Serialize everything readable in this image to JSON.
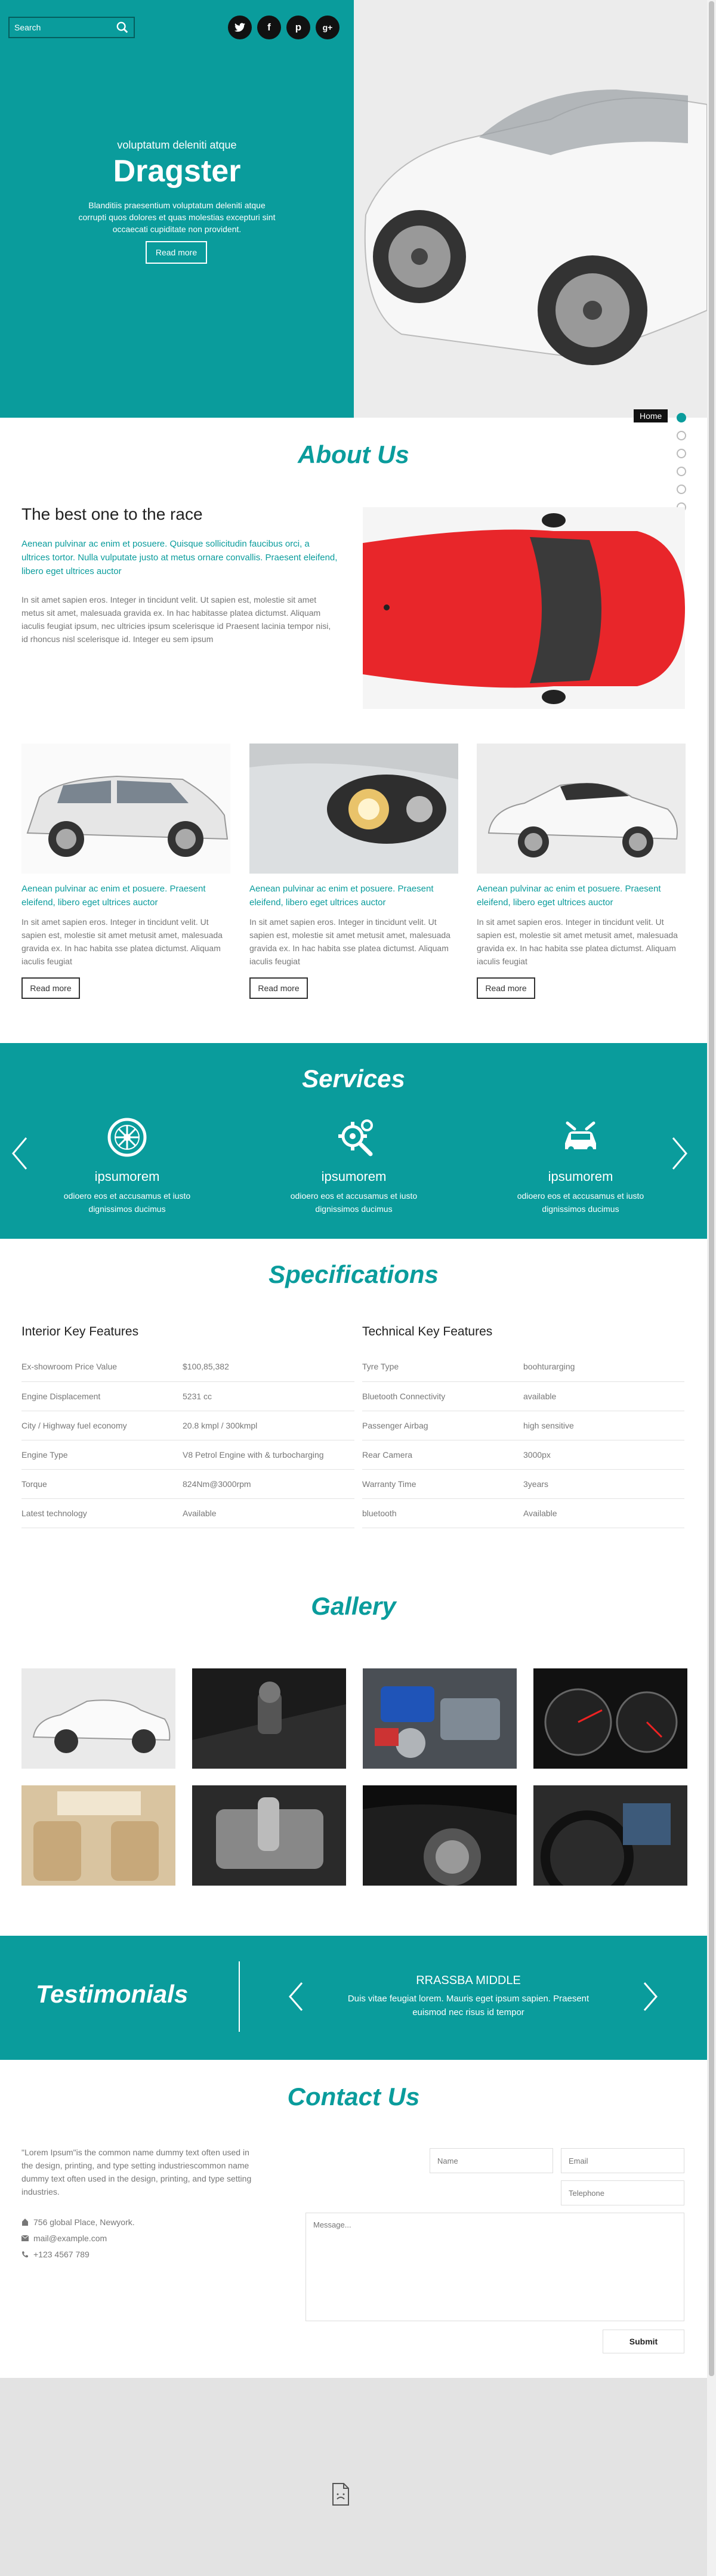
{
  "search": {
    "placeholder": "Search"
  },
  "social": [
    {
      "icon": "twitter-icon",
      "glyph": "t"
    },
    {
      "icon": "facebook-icon",
      "glyph": "f"
    },
    {
      "icon": "pinterest-icon",
      "glyph": "p"
    },
    {
      "icon": "google-plus-icon",
      "glyph": "g+"
    }
  ],
  "hero": {
    "subtitle": "voluptatum deleniti atque",
    "title": "Dragster",
    "text": "Blanditiis praesentium voluptatum deleniti atque corrupti quos dolores et quas molestias excepturi sint occaecati cupiditate non provident.",
    "button": "Read more"
  },
  "nav": {
    "home": "Home",
    "dot_count": 6
  },
  "about": {
    "title": "About Us",
    "heading": "The best one to the race",
    "lead": "Aenean pulvinar ac enim et posuere. Quisque sollicitudin faucibus orci, a ultrices tortor. Nulla vulputate justo at metus ornare convallis. Praesent eleifend, libero eget ultrices auctor",
    "text": "In sit amet sapien eros. Integer in tincidunt velit. Ut sapien est, molestie sit amet metus sit amet, malesuada gravida ex. In hac habitasse platea dictumst. Aliquam iaculis feugiat ipsum, nec ultricies ipsum scelerisque id Praesent lacinia tempor nisi, id rhoncus nisl scelerisque id. Integer eu sem ipsum"
  },
  "cards": [
    {
      "lead": "Aenean pulvinar ac enim et posuere. Praesent eleifend, libero eget ultrices auctor",
      "text": "In sit amet sapien eros. Integer in tincidunt velit. Ut sapien est, molestie sit amet metusit amet, malesuada gravida ex. In hac habita sse platea dictumst. Aliquam iaculis feugiat",
      "button": "Read more"
    },
    {
      "lead": "Aenean pulvinar ac enim et posuere. Praesent eleifend, libero eget ultrices auctor",
      "text": "In sit amet sapien eros. Integer in tincidunt velit. Ut sapien est, molestie sit amet metusit amet, malesuada gravida ex. In hac habita sse platea dictumst. Aliquam iaculis feugiat",
      "button": "Read more"
    },
    {
      "lead": "Aenean pulvinar ac enim et posuere. Praesent eleifend, libero eget ultrices auctor",
      "text": "In sit amet sapien eros. Integer in tincidunt velit. Ut sapien est, molestie sit amet metusit amet, malesuada gravida ex. In hac habita sse platea dictumst. Aliquam iaculis feugiat",
      "button": "Read more"
    }
  ],
  "services": {
    "title": "Services",
    "items": [
      {
        "icon": "wheel-icon",
        "name": "ipsumorem",
        "text": "odioero eos et accusamus et iusto dignissimos ducimus"
      },
      {
        "icon": "wrench-gear-icon",
        "name": "ipsumorem",
        "text": "odioero eos et accusamus et iusto dignissimos ducimus"
      },
      {
        "icon": "car-repair-icon",
        "name": "ipsumorem",
        "text": "odioero eos et accusamus et iusto dignissimos ducimus"
      }
    ]
  },
  "specs": {
    "title": "Specifications",
    "interior": {
      "heading": "Interior Key Features",
      "rows": [
        [
          "Ex-showroom Price Value",
          "$100,85,382"
        ],
        [
          "Engine Displacement",
          "5231 cc"
        ],
        [
          "City / Highway fuel economy",
          "20.8 kmpl / 300kmpl"
        ],
        [
          "Engine Type",
          "V8 Petrol Engine with & turbocharging"
        ],
        [
          "Torque",
          "824Nm@3000rpm"
        ],
        [
          "Latest technology",
          "Available"
        ]
      ]
    },
    "technical": {
      "heading": "Technical Key Features",
      "rows": [
        [
          "Tyre Type",
          "boohturarging"
        ],
        [
          "Bluetooth Connectivity",
          "available"
        ],
        [
          "Passenger Airbag",
          "high sensitive"
        ],
        [
          "Rear Camera",
          "3000px"
        ],
        [
          "Warranty Time",
          "3years"
        ],
        [
          "bluetooth",
          "Available"
        ]
      ]
    }
  },
  "gallery": {
    "title": "Gallery"
  },
  "testimonials": {
    "title": "Testimonials",
    "name": "RRASSBA MIDDLE",
    "text": "Duis vitae feugiat lorem. Mauris eget ipsum sapien. Praesent euismod nec risus id tempor"
  },
  "contact": {
    "title": "Contact Us",
    "text": "\"Lorem Ipsum\"is the common name dummy text often used in the design, printing, and type setting industriescommon name dummy text often used in the design, printing, and type setting industries.",
    "address": "756 global Place, Newyork.",
    "email": "mail@example.com",
    "phone": "+123 4567 789",
    "name_placeholder": "Name",
    "email_placeholder": "Email",
    "telephone_placeholder": "Telephone",
    "message_placeholder": "Message...",
    "submit": "Submit"
  },
  "colors": {
    "accent": "#0a9c9c",
    "dark": "#111111",
    "footer": "#e3e3e3"
  }
}
